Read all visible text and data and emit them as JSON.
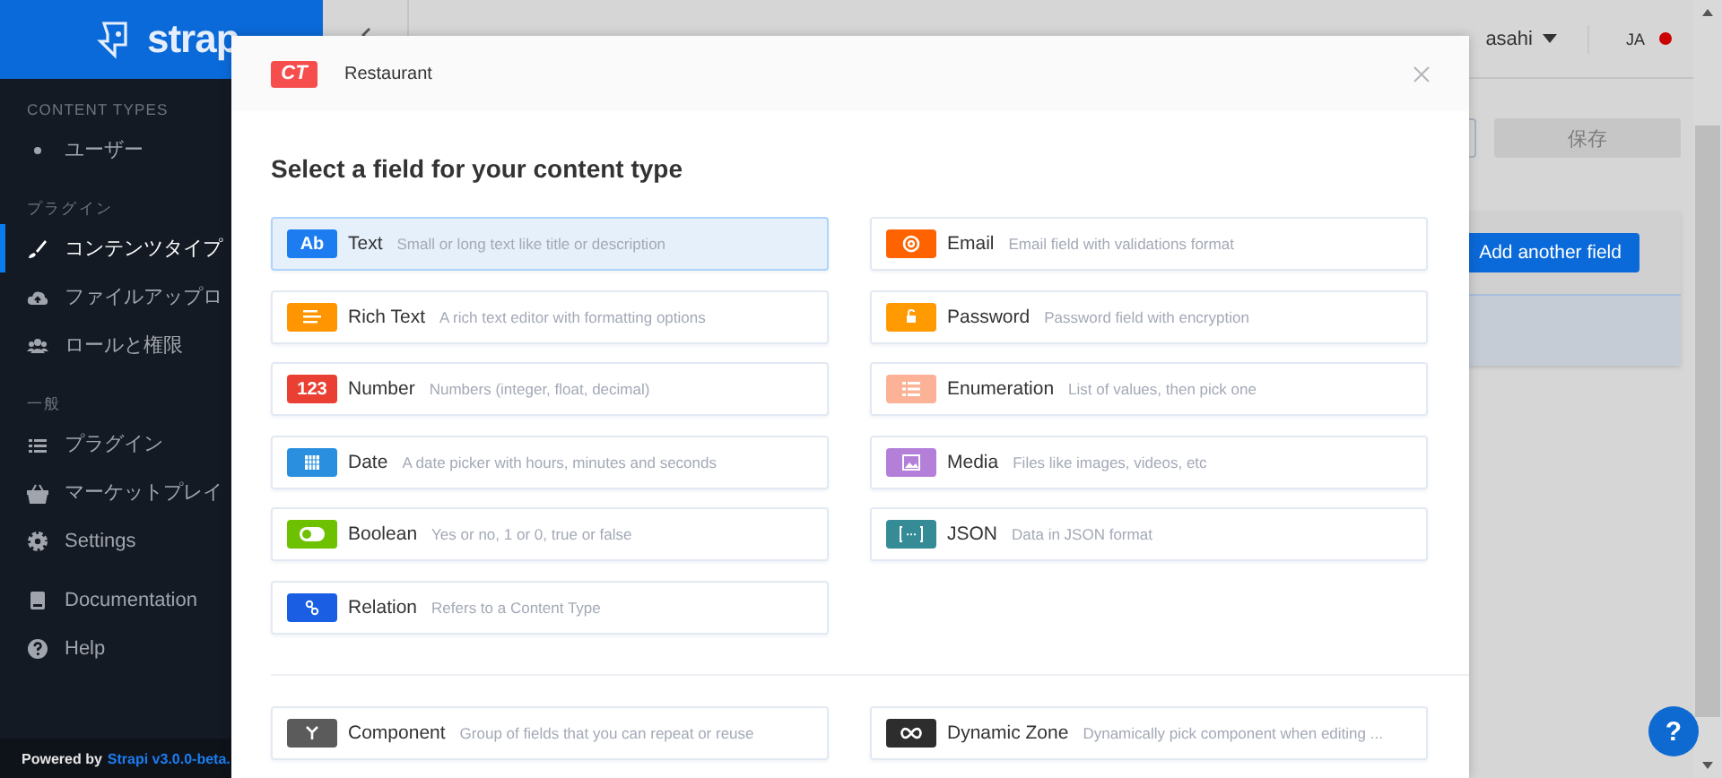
{
  "sidebar": {
    "logo": "strap",
    "sections": [
      {
        "title": "CONTENT TYPES",
        "items": [
          {
            "label": "ユーザー",
            "selected": false
          }
        ]
      },
      {
        "title": "プラグイン",
        "items": [
          {
            "label": "コンテンツタイプ",
            "selected": true
          },
          {
            "label": "ファイルアップロ",
            "selected": false
          },
          {
            "label": "ロールと権限",
            "selected": false
          }
        ]
      },
      {
        "title": "一般",
        "items": [
          {
            "label": "プラグイン",
            "selected": false
          },
          {
            "label": "マーケットプレイ",
            "selected": false
          },
          {
            "label": "Settings",
            "selected": false
          }
        ]
      }
    ],
    "links": [
      {
        "label": "Documentation"
      },
      {
        "label": "Help"
      }
    ],
    "footer": {
      "prefix": "Powered by",
      "link": "Strapi v3.0.0-beta."
    }
  },
  "header": {
    "user": "asahi",
    "language": "JA"
  },
  "toolbar": {
    "save": "保存",
    "disabled": true
  },
  "card": {
    "button": "Add another field"
  },
  "modal": {
    "badge": "CT",
    "title": "Restaurant",
    "heading": "Select a field for your content type",
    "fields": [
      {
        "kind": "text",
        "badge": "Ab",
        "color": "#1c7cf0",
        "name": "Text",
        "description": "Small or long text like title or description",
        "selected": true
      },
      {
        "kind": "email",
        "color": "#ff6300",
        "name": "Email",
        "description": "Email field with validations format",
        "selected": false
      },
      {
        "kind": "richtext",
        "color": "#ff9500",
        "name": "Rich Text",
        "description": "A rich text editor with formatting options",
        "selected": false
      },
      {
        "kind": "password",
        "color": "#ff9b00",
        "name": "Password",
        "description": "Password field with encryption",
        "selected": false
      },
      {
        "kind": "number",
        "badge": "123",
        "color": "#e94033",
        "name": "Number",
        "description": "Numbers (integer, float, decimal)",
        "selected": false
      },
      {
        "kind": "enumeration",
        "color": "#fbb297",
        "name": "Enumeration",
        "description": "List of values, then pick one",
        "selected": false
      },
      {
        "kind": "date",
        "color": "#2a8fde",
        "name": "Date",
        "description": "A date picker with hours, minutes and seconds",
        "selected": false
      },
      {
        "kind": "media",
        "color": "#b47fd8",
        "name": "Media",
        "description": "Files like images, videos, etc",
        "selected": false
      },
      {
        "kind": "boolean",
        "color": "#6ec101",
        "name": "Boolean",
        "description": "Yes or no, 1 or 0, true or false",
        "selected": false
      },
      {
        "kind": "json",
        "color": "#358b96",
        "name": "JSON",
        "description": "Data in JSON format",
        "selected": false
      },
      {
        "kind": "relation",
        "color": "#1a5ee3",
        "name": "Relation",
        "description": "Refers to a Content Type",
        "selected": false
      }
    ],
    "extra_fields": [
      {
        "kind": "component",
        "color": "#5b5b5b",
        "name": "Component",
        "description": "Group of fields that you can repeat or reuse",
        "selected": false
      },
      {
        "kind": "dynamiczone",
        "color": "#2d2d2d",
        "name": "Dynamic Zone",
        "description": "Dynamically pick component when editing ...",
        "selected": false
      }
    ]
  },
  "help_button": "?"
}
